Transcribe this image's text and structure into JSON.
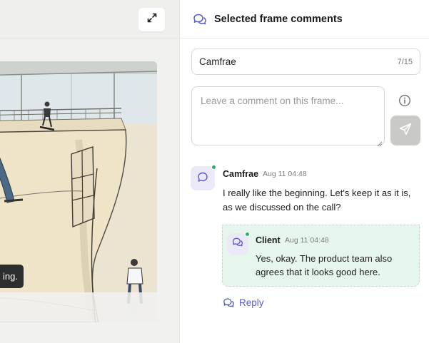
{
  "viewer": {
    "expand_icon": "expand-arrows-icon",
    "caption_fragment": "ing."
  },
  "panel": {
    "header_icon": "comments-icon",
    "title": "Selected frame comments",
    "name_input": {
      "value": "Camfrae",
      "counter": "7/15"
    },
    "comment_input": {
      "placeholder": "Leave a comment on this frame..."
    },
    "info_icon": "info-icon",
    "send_icon": "send-icon"
  },
  "comments": [
    {
      "author": "Camfrae",
      "time": "Aug 11 04:48",
      "body_line1": "I really like the beginning. Let's keep it as it is,",
      "body_line2": "as we discussed on the call?",
      "avatar_icon": "chat-bubble-icon",
      "online": true
    }
  ],
  "reply": {
    "author": "Client",
    "time": "Aug 11 04:48",
    "body_line1": "Yes, okay. The product team also",
    "body_line2": "agrees that it looks good here.",
    "avatar_icon": "comments-icon",
    "online": true
  },
  "reply_link": {
    "label": "Reply",
    "icon": "reply-bubbles-icon"
  },
  "colors": {
    "accent": "#5a5bc7",
    "online": "#2fae66",
    "reply_bg": "#e7f6ec",
    "avatar_bg": "#ebe8f8",
    "send_disabled": "#c9c9c6"
  }
}
